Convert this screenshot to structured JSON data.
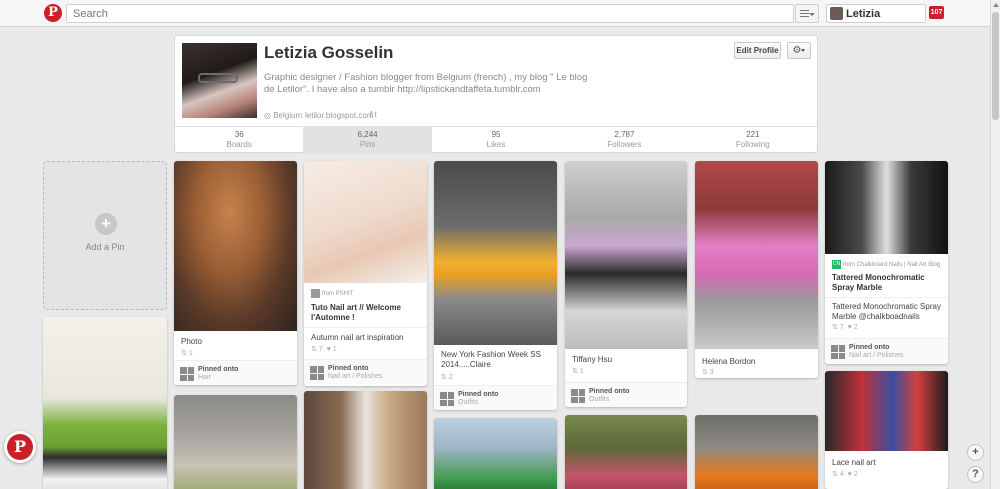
{
  "topbar": {
    "logo": "P",
    "search_placeholder": "Search",
    "user_name": "Letizia",
    "notification_count": "107"
  },
  "profile": {
    "name": "Letizia Gosselin",
    "bio": "Graphic designer / Fashion blogger from Belgium (french) , my blog \" Le blog de Letilor\". I have also a tumblr http://lipstickandtaffeta.tumblr.com",
    "location": "Belgium",
    "website": "letilor.blogspot.com",
    "edit_label": "Edit Profile",
    "stats": [
      {
        "num": "36",
        "label": "Boards"
      },
      {
        "num": "6,244",
        "label": "Pins"
      },
      {
        "num": "95",
        "label": "Likes"
      },
      {
        "num": "2,787",
        "label": "Followers"
      },
      {
        "num": "221",
        "label": "Following"
      }
    ]
  },
  "add_pin_label": "Add a Pin",
  "pins": {
    "photo": {
      "desc": "Photo",
      "repins": "1",
      "board_label": "Pinned onto",
      "board": "Hair"
    },
    "nail": {
      "source": "from PSHIT",
      "title": "Tuto Nail art // Welcome l'Automne !",
      "desc": "Autumn nail art inspiration",
      "repins": "7",
      "likes": "1",
      "board_label": "Pinned onto",
      "board": "Nail art / Polishes"
    },
    "nyfw": {
      "desc": "New York Fashion Week SS 2014.....Claire",
      "repins": "2",
      "board_label": "Pinned onto",
      "board": "Outfits"
    },
    "tiffany": {
      "desc": "Tiffany Hsu",
      "repins": "1",
      "board_label": "Pinned onto",
      "board": "Outfits"
    },
    "helena": {
      "desc": "Helena Bordon",
      "repins": "3",
      "board_label": "Pinned onto",
      "board": "Outfits"
    },
    "tattered": {
      "source_badge": "CN",
      "source": "from Chalkboard Nails | Nail Art Blog",
      "title": "Tattered Monochromatic Spray Marble",
      "desc": "Tattered Monochromatic Spray Marble @chalkboadnails",
      "repins": "7",
      "likes": "2",
      "board_label": "Pinned onto",
      "board": "Nail art / Polishes"
    },
    "lace": {
      "desc": "Lace nail art",
      "repins": "4",
      "likes": "2"
    }
  }
}
